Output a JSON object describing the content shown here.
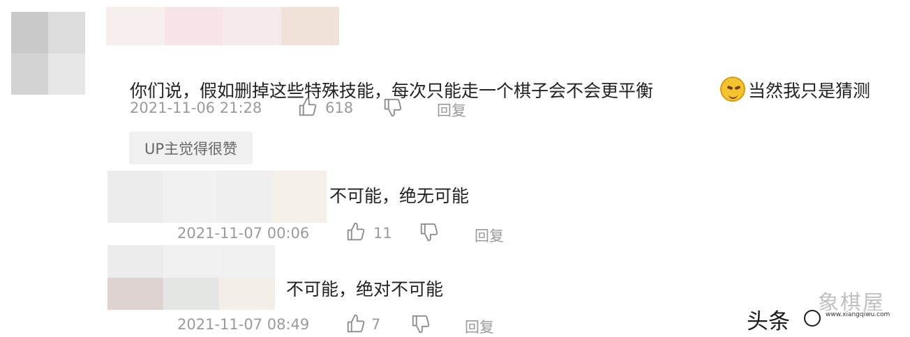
{
  "comments": [
    {
      "text_main": "你们说，假如删掉这些特殊技能，每次只能走一个棋子会不会更平衡",
      "text_tail": "当然我只是猜测",
      "timestamp": "2021-11-06 21:28",
      "likes": "618",
      "reply_label": "回复",
      "badge": "UP主觉得很赞"
    },
    {
      "text_main": "不可能，绝无可能",
      "timestamp": "2021-11-07 00:06",
      "likes": "11",
      "reply_label": "回复"
    },
    {
      "text_main": "不可能，绝对不可能",
      "timestamp": "2021-11-07 08:49",
      "likes": "7",
      "reply_label": "回复"
    }
  ],
  "watermark": {
    "platform": "头条",
    "brand": "象棋屋",
    "url": "www.xiangqiwu.com"
  },
  "icons": {
    "like": "thumbs-up-icon",
    "dislike": "thumbs-down-icon",
    "emoji": "squinting-face-emoji"
  },
  "colors": {
    "text": "#222222",
    "meta": "#9a9a9a",
    "badge_bg": "#f0f0f0"
  }
}
